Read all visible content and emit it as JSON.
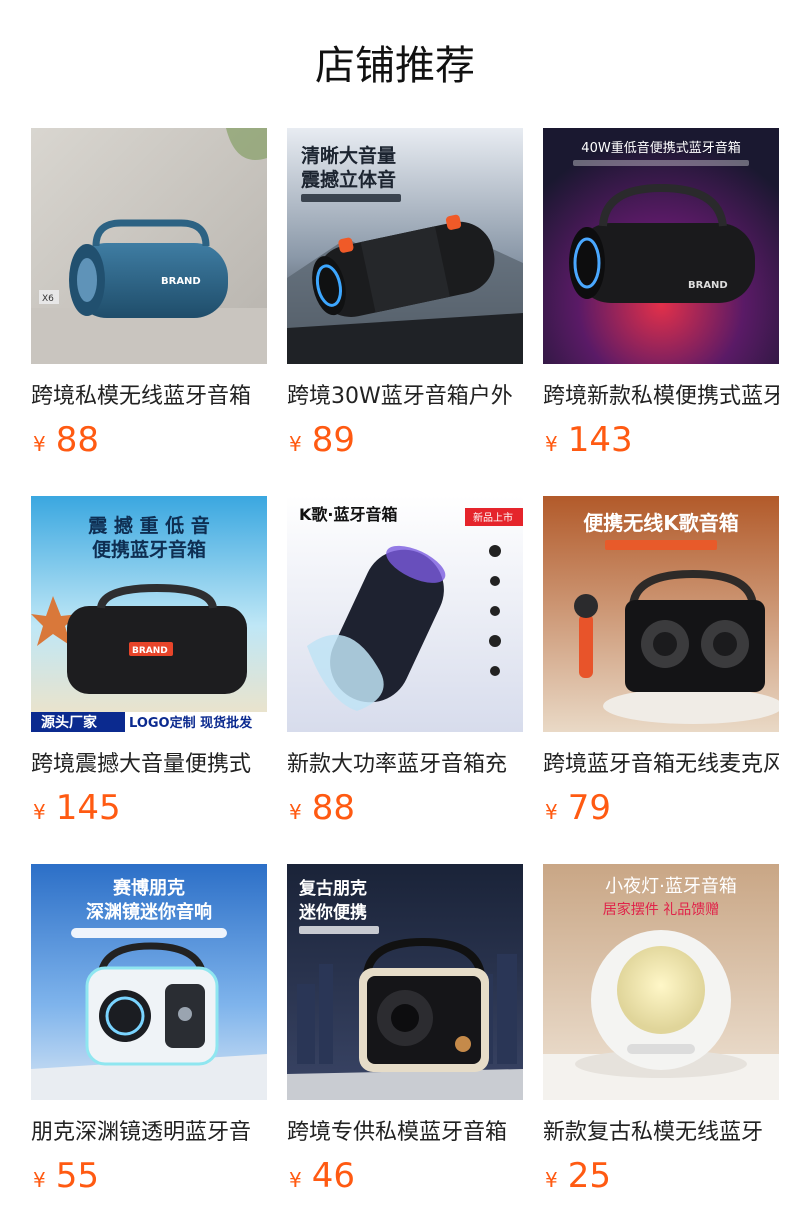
{
  "section": {
    "title": "店铺推荐"
  },
  "products": [
    {
      "name": "跨境私模无线蓝牙音箱",
      "currency": "¥",
      "price": "88",
      "image_text": {
        "badge": "X6",
        "brand": "BRAND"
      }
    },
    {
      "name": "跨境30W蓝牙音箱户外",
      "currency": "¥",
      "price": "89",
      "image_text": {
        "headline1": "清晰大音量",
        "headline2": "震撼立体音"
      }
    },
    {
      "name": "跨境新款私模便携式蓝牙",
      "currency": "¥",
      "price": "143",
      "image_text": {
        "headline": "40W重低音便携式蓝牙音箱",
        "brand": "BRAND"
      }
    },
    {
      "name": "跨境震撼大音量便携式",
      "currency": "¥",
      "price": "145",
      "image_text": {
        "headline1": "震 撼 重 低 音",
        "headline2": "便携蓝牙音箱",
        "brand": "BRAND",
        "banner_left": "源头厂家",
        "banner_right": "LOGO定制 现货批发"
      }
    },
    {
      "name": "新款大功率蓝牙音箱充",
      "currency": "¥",
      "price": "88",
      "image_text": {
        "headline": "K歌·蓝牙音箱",
        "tag": "新品上市"
      }
    },
    {
      "name": "跨境蓝牙音箱无线麦克风",
      "currency": "¥",
      "price": "79",
      "image_text": {
        "headline": "便携无线K歌音箱"
      }
    },
    {
      "name": "朋克深渊镜透明蓝牙音",
      "currency": "¥",
      "price": "55",
      "image_text": {
        "headline1": "赛博朋克",
        "headline2": "深渊镜迷你音响"
      }
    },
    {
      "name": "跨境专供私模蓝牙音箱",
      "currency": "¥",
      "price": "46",
      "image_text": {
        "headline1": "复古朋克",
        "headline2": "迷你便携"
      }
    },
    {
      "name": "新款复古私模无线蓝牙",
      "currency": "¥",
      "price": "25",
      "image_text": {
        "headline": "小夜灯·蓝牙音箱",
        "subline": "居家摆件 礼品馈赠"
      }
    }
  ]
}
